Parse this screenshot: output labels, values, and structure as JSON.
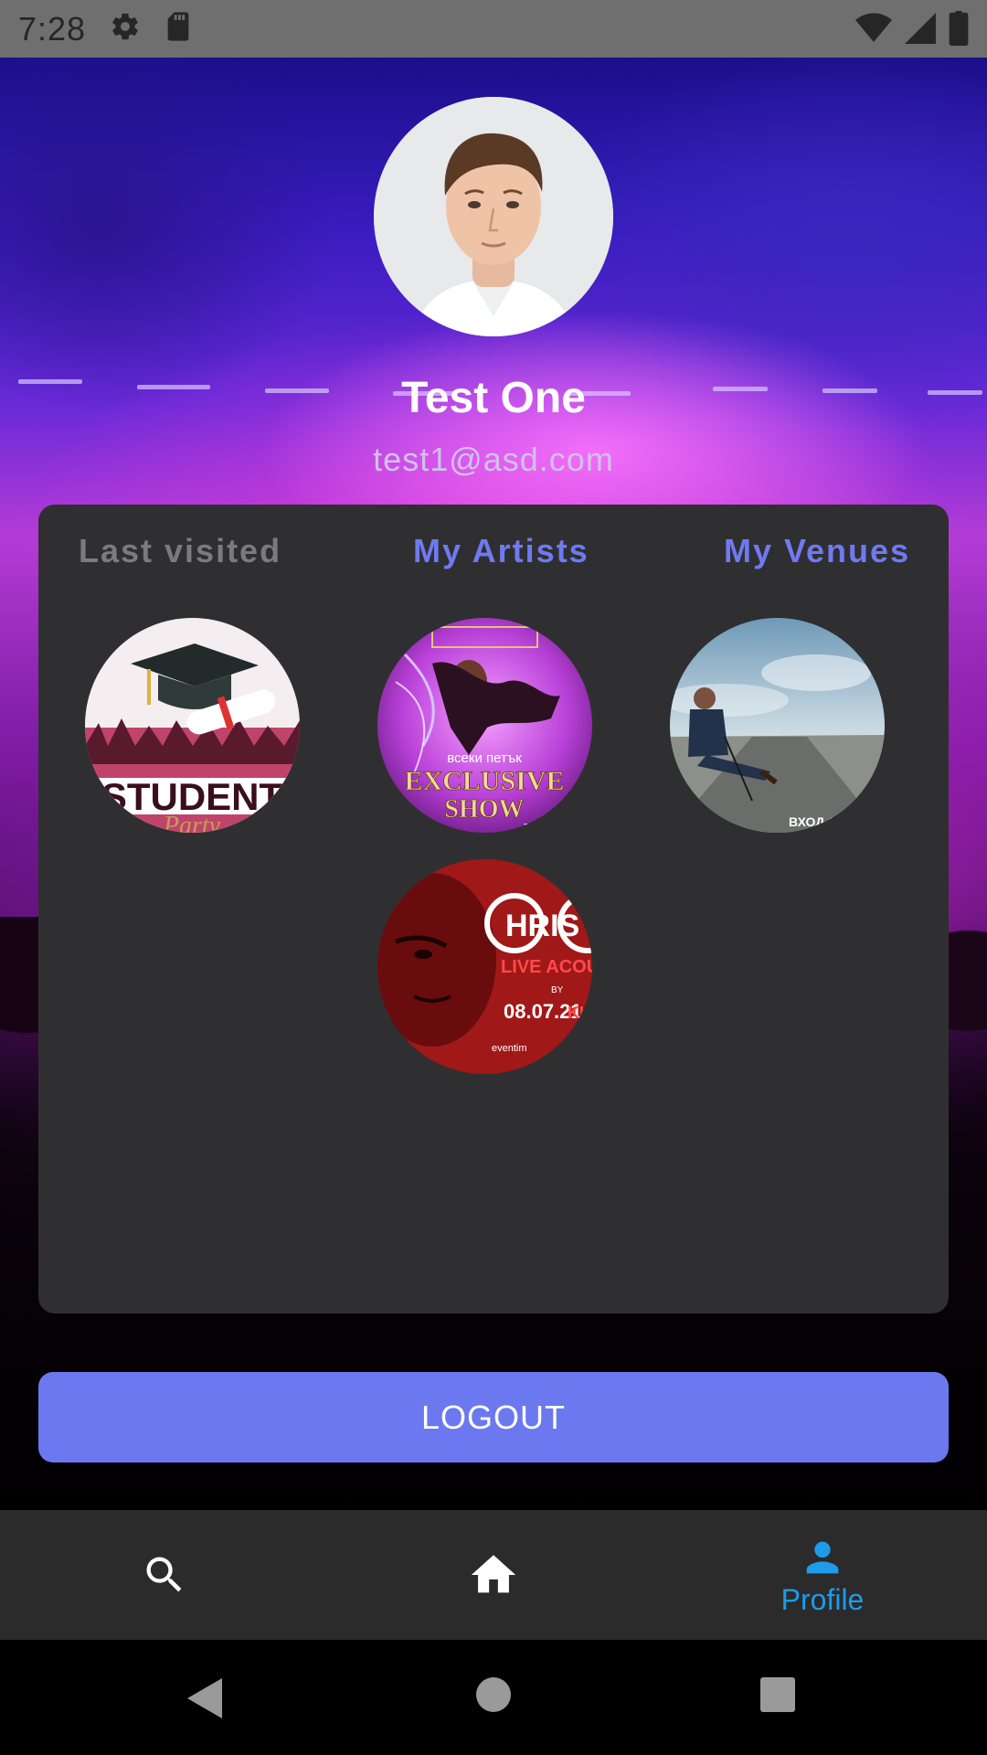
{
  "status_bar": {
    "time": "7:28",
    "icons": [
      "settings-gear-icon",
      "sd-card-icon",
      "wifi-icon",
      "cell-signal-icon",
      "battery-icon"
    ]
  },
  "profile": {
    "name": "Test One",
    "email": "test1@asd.com"
  },
  "tabs": [
    {
      "label": "Last visited",
      "active": true
    },
    {
      "label": "My Artists",
      "active": false
    },
    {
      "label": "My Venues",
      "active": false
    }
  ],
  "tiles": [
    {
      "texts": [
        "STUDENT",
        "Party"
      ]
    },
    {
      "texts": [
        "всеки петък",
        "EXCLUSIVE",
        "SHOW",
        "RSVP"
      ]
    },
    {
      "texts": [
        "ВХОД СВОБ"
      ]
    },
    {
      "texts": [
        "HRIS",
        "LIVE ACOUST",
        "BY",
        "08.07.21",
        "KIN",
        "eventim"
      ]
    }
  ],
  "logout_label": "LOGOUT",
  "bottom_nav": {
    "items": [
      {
        "icon": "search-icon",
        "label": ""
      },
      {
        "icon": "home-icon",
        "label": ""
      },
      {
        "icon": "person-icon",
        "label": "Profile",
        "active": true
      }
    ]
  },
  "colors": {
    "accent": "#6c78ef",
    "active_nav": "#1e9be9",
    "card": "#2f2f31",
    "nav_bar": "#2b2b2b"
  }
}
